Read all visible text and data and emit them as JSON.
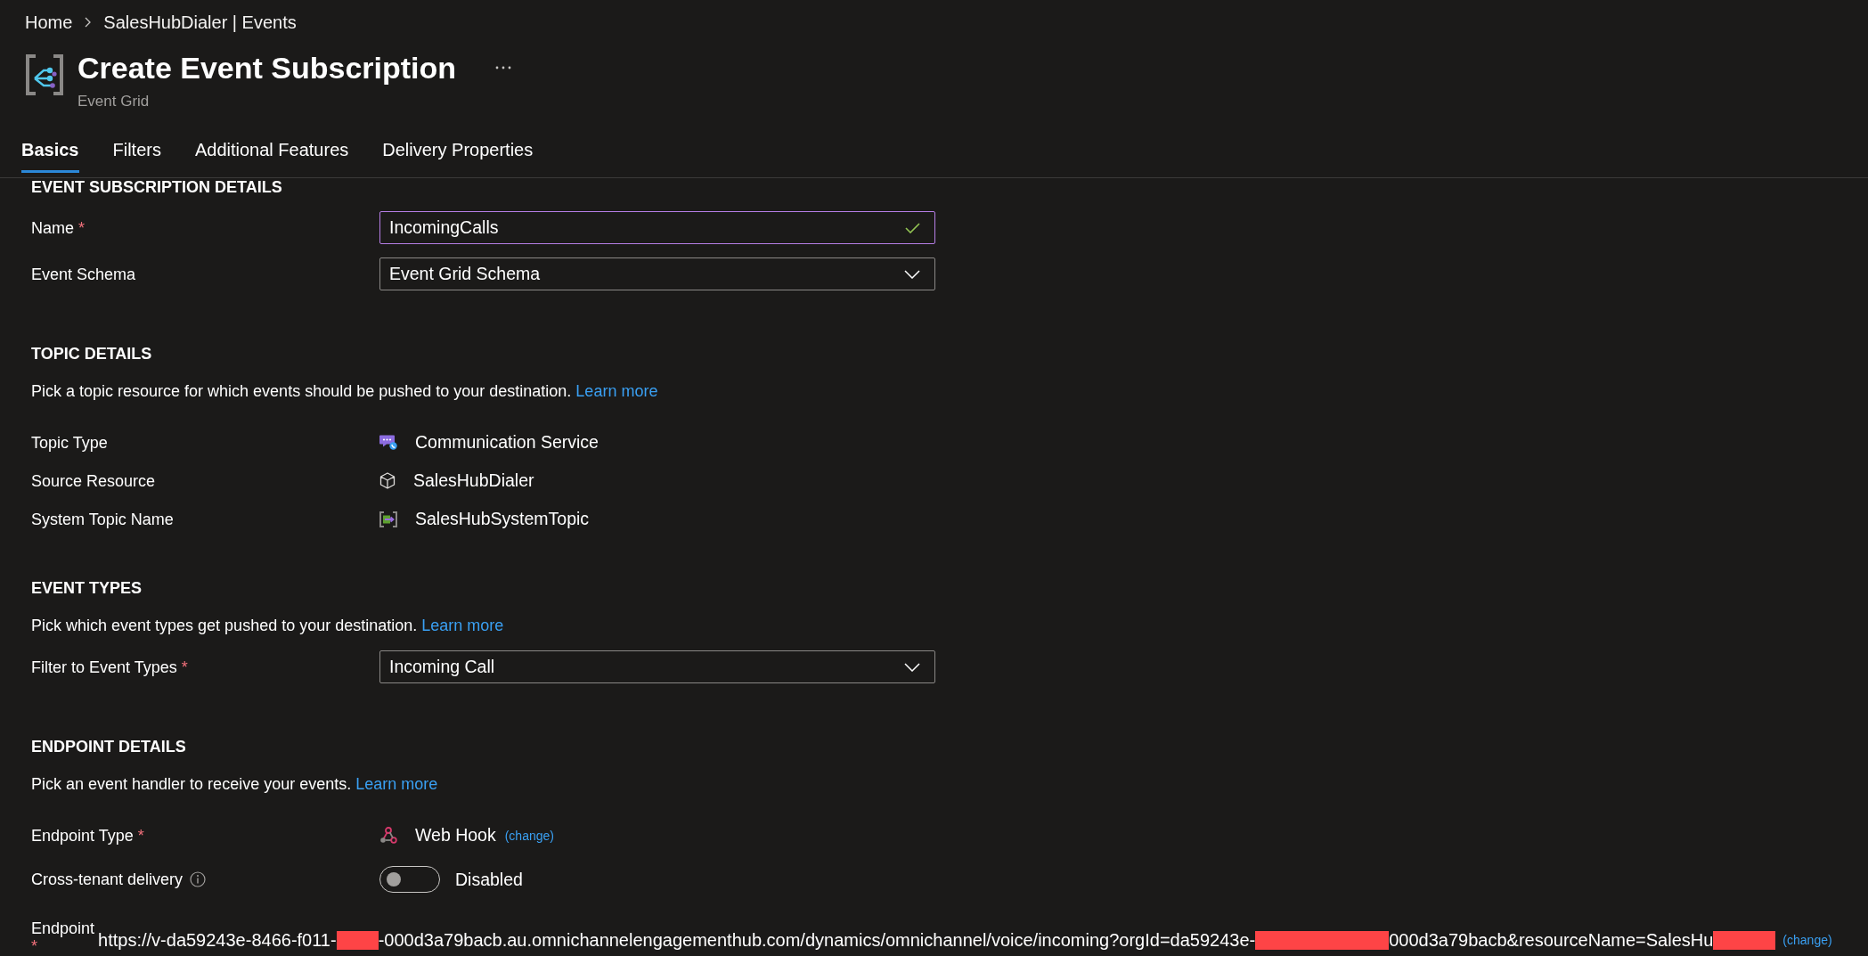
{
  "breadcrumb": [
    {
      "text": "Home"
    },
    {
      "text": "SalesHubDialer | Events"
    }
  ],
  "header": {
    "title": "Create Event Subscription",
    "subtitle": "Event Grid"
  },
  "tabs": [
    {
      "label": "Basics",
      "selected": true
    },
    {
      "label": "Filters",
      "selected": false
    },
    {
      "label": "Additional Features",
      "selected": false
    },
    {
      "label": "Delivery Properties",
      "selected": false
    }
  ],
  "sections": [
    {
      "heading": "EVENT SUBSCRIPTION DETAILS",
      "fields": [
        {
          "kind": "input",
          "label": "Name",
          "required_mark": "*",
          "value": "IncomingCalls",
          "focused": true,
          "valid": true
        },
        {
          "kind": "dropdown",
          "label": "Event Schema",
          "value": "Event Grid Schema"
        }
      ]
    },
    {
      "heading": "TOPIC DETAILS",
      "description": "Pick a topic resource for which events should be pushed to your destination.",
      "link": "Learn more",
      "fields": [
        {
          "kind": "service",
          "label": "Topic Type",
          "value": "Communication Service"
        },
        {
          "kind": "resource",
          "label": "Source Resource",
          "value": "SalesHubDialer"
        },
        {
          "kind": "topic",
          "label": "System Topic Name",
          "value": "SalesHubSystemTopic"
        }
      ]
    },
    {
      "heading": "EVENT TYPES",
      "description": "Pick which event types get pushed to your destination.",
      "link": "Learn more",
      "fields": [
        {
          "kind": "dropdown",
          "label": "Filter to Event Types",
          "required_mark": "*",
          "value": "Incoming Call"
        }
      ]
    },
    {
      "heading": "ENDPOINT DETAILS",
      "description": "Pick an event handler to receive your events.",
      "link": "Learn more",
      "fields": [
        {
          "kind": "webhook",
          "label": "Endpoint Type",
          "required_mark": "*",
          "value": "Web Hook",
          "action": "(change)"
        },
        {
          "kind": "toggle",
          "label": "Cross-tenant delivery",
          "info": true,
          "on": false,
          "state_text": "Disabled"
        },
        {
          "kind": "url",
          "label": "Endpoint",
          "required_mark": "*",
          "parts": [
            {
              "kind": "text",
              "text": "https://v-da59243e-8466-f011-"
            },
            {
              "kind": "redacted"
            },
            {
              "kind": "text",
              "text": "-000d3a79bacb.au.omnichannelengagementhub.com/dynamics/omnichannel/voice/incoming?orgId=da59243e-"
            },
            {
              "kind": "redacted"
            },
            {
              "kind": "text",
              "text": "000d3a79bacb&resourceName=SalesHu"
            },
            {
              "kind": "redacted"
            }
          ],
          "action": "(change)"
        }
      ]
    }
  ]
}
